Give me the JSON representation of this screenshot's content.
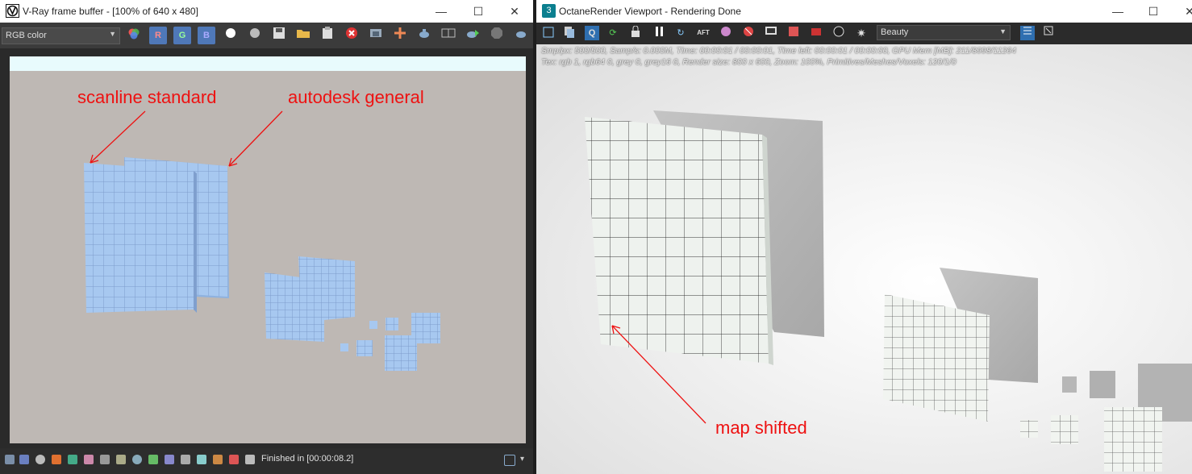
{
  "vray": {
    "title": "V-Ray frame buffer - [100% of 640 x 480]",
    "channel_select": "RGB color",
    "channel_buttons": {
      "r": "R",
      "g": "G",
      "b": "B"
    },
    "status_text": "Finished in [00:00:08.2]",
    "annotations": {
      "left": "scanline standard",
      "right": "autodesk general"
    },
    "colors": {
      "frame_bg": "#beb8b4",
      "tile": "#a7c8f0",
      "annotation": "#ee1111"
    }
  },
  "octane": {
    "title": "OctaneRender Viewport - Rendering Done",
    "app_icon_label": "3",
    "q_button": "Q",
    "aft_button": "AFT",
    "pass_select": "Beauty",
    "stats_line1": "Smp/px: 500/500,   Samp/s: 0.000M,   Time: 00:00:01 / 00:00:01,   Time left: 00:00:01 / 00:00:00,   GPU Mem [MB]: 211/8998/11264",
    "stats_line2": "Tex: rgb 1, rgb64 0, grey 0, grey16 0,   Render size: 800 x 600,   Zoom: 100%,   Primitives/Meshes/Voxels: 120/1/0",
    "annotation": "map shifted"
  },
  "window_controls": {
    "minimize": "—",
    "maximize": "☐",
    "close": "✕"
  }
}
